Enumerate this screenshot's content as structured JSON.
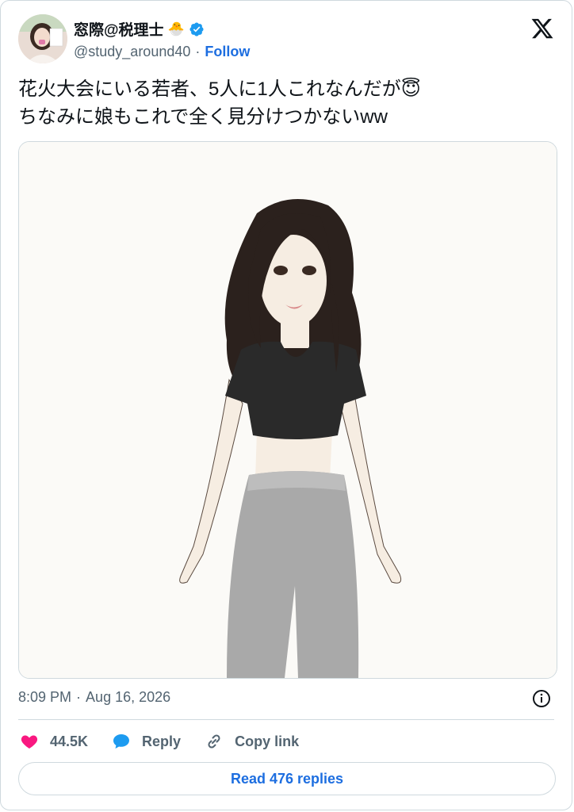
{
  "author": {
    "name": "窓際@税理士",
    "name_emoji": "🐣",
    "handle": "@study_around40",
    "separator": "·",
    "follow_label": "Follow"
  },
  "tweet": {
    "line1": "花火大会にいる若者、5人に1人これなんだが",
    "line1_emoji": "😇",
    "line2": "ちなみに娘もこれで全く見分けつかないww"
  },
  "meta": {
    "time": "8:09 PM",
    "separator": "·",
    "date": "Aug 16, 2026"
  },
  "actions": {
    "likes": "44.5K",
    "reply_label": "Reply",
    "copy_label": "Copy link"
  },
  "read_replies_label": "Read 476 replies",
  "colors": {
    "accent": "#1d6ee0",
    "like": "#f91880",
    "verified": "#1d9bf0",
    "muted": "#536471",
    "border": "#cfd9de"
  },
  "icons": [
    "x-logo-icon",
    "verified-icon",
    "heart-icon",
    "reply-bubble-icon",
    "link-icon",
    "info-icon"
  ]
}
